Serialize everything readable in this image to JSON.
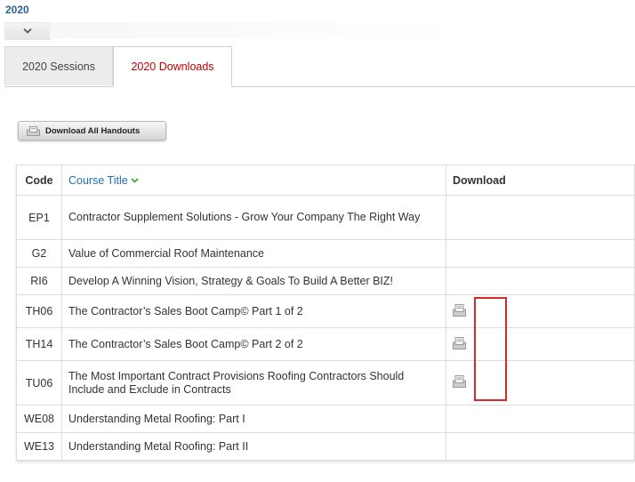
{
  "header": {
    "year": "2020"
  },
  "tabs": [
    {
      "label": "2020 Sessions",
      "active": false
    },
    {
      "label": "2020 Downloads",
      "active": true
    }
  ],
  "download_all": {
    "label": "Download All Handouts",
    "icon": "document-icon"
  },
  "table": {
    "columns": {
      "code": "Code",
      "title": "Course Title",
      "download": "Download"
    },
    "sort": {
      "column": "title",
      "icon": "chevron-down-icon",
      "color": "#3aaa35"
    },
    "rows": [
      {
        "code": "EP1",
        "title": "Contractor Supplement Solutions - Grow Your Company The Right Way",
        "has_download": false
      },
      {
        "code": "G2",
        "title": "Value of Commercial Roof Maintenance",
        "has_download": false
      },
      {
        "code": "RI6",
        "title": "Develop A Winning Vision, Strategy & Goals To Build A Better BIZ!",
        "has_download": false
      },
      {
        "code": "TH06",
        "title": "The Contractor’s Sales Boot Camp© Part 1 of 2",
        "has_download": true
      },
      {
        "code": "TH14",
        "title": "The Contractor’s Sales Boot Camp© Part 2 of 2",
        "has_download": true
      },
      {
        "code": "TU06",
        "title": "The Most Important Contract Provisions Roofing Contractors Should Include and Exclude in Contracts",
        "has_download": true
      },
      {
        "code": "WE08",
        "title": "Understanding Metal Roofing: Part I",
        "has_download": false
      },
      {
        "code": "WE13",
        "title": "Understanding Metal Roofing: Part II",
        "has_download": false
      }
    ]
  },
  "colors": {
    "accent_link": "#1f6fb5",
    "active_tab_text": "#c00000",
    "highlight_box": "#d62a2a"
  }
}
